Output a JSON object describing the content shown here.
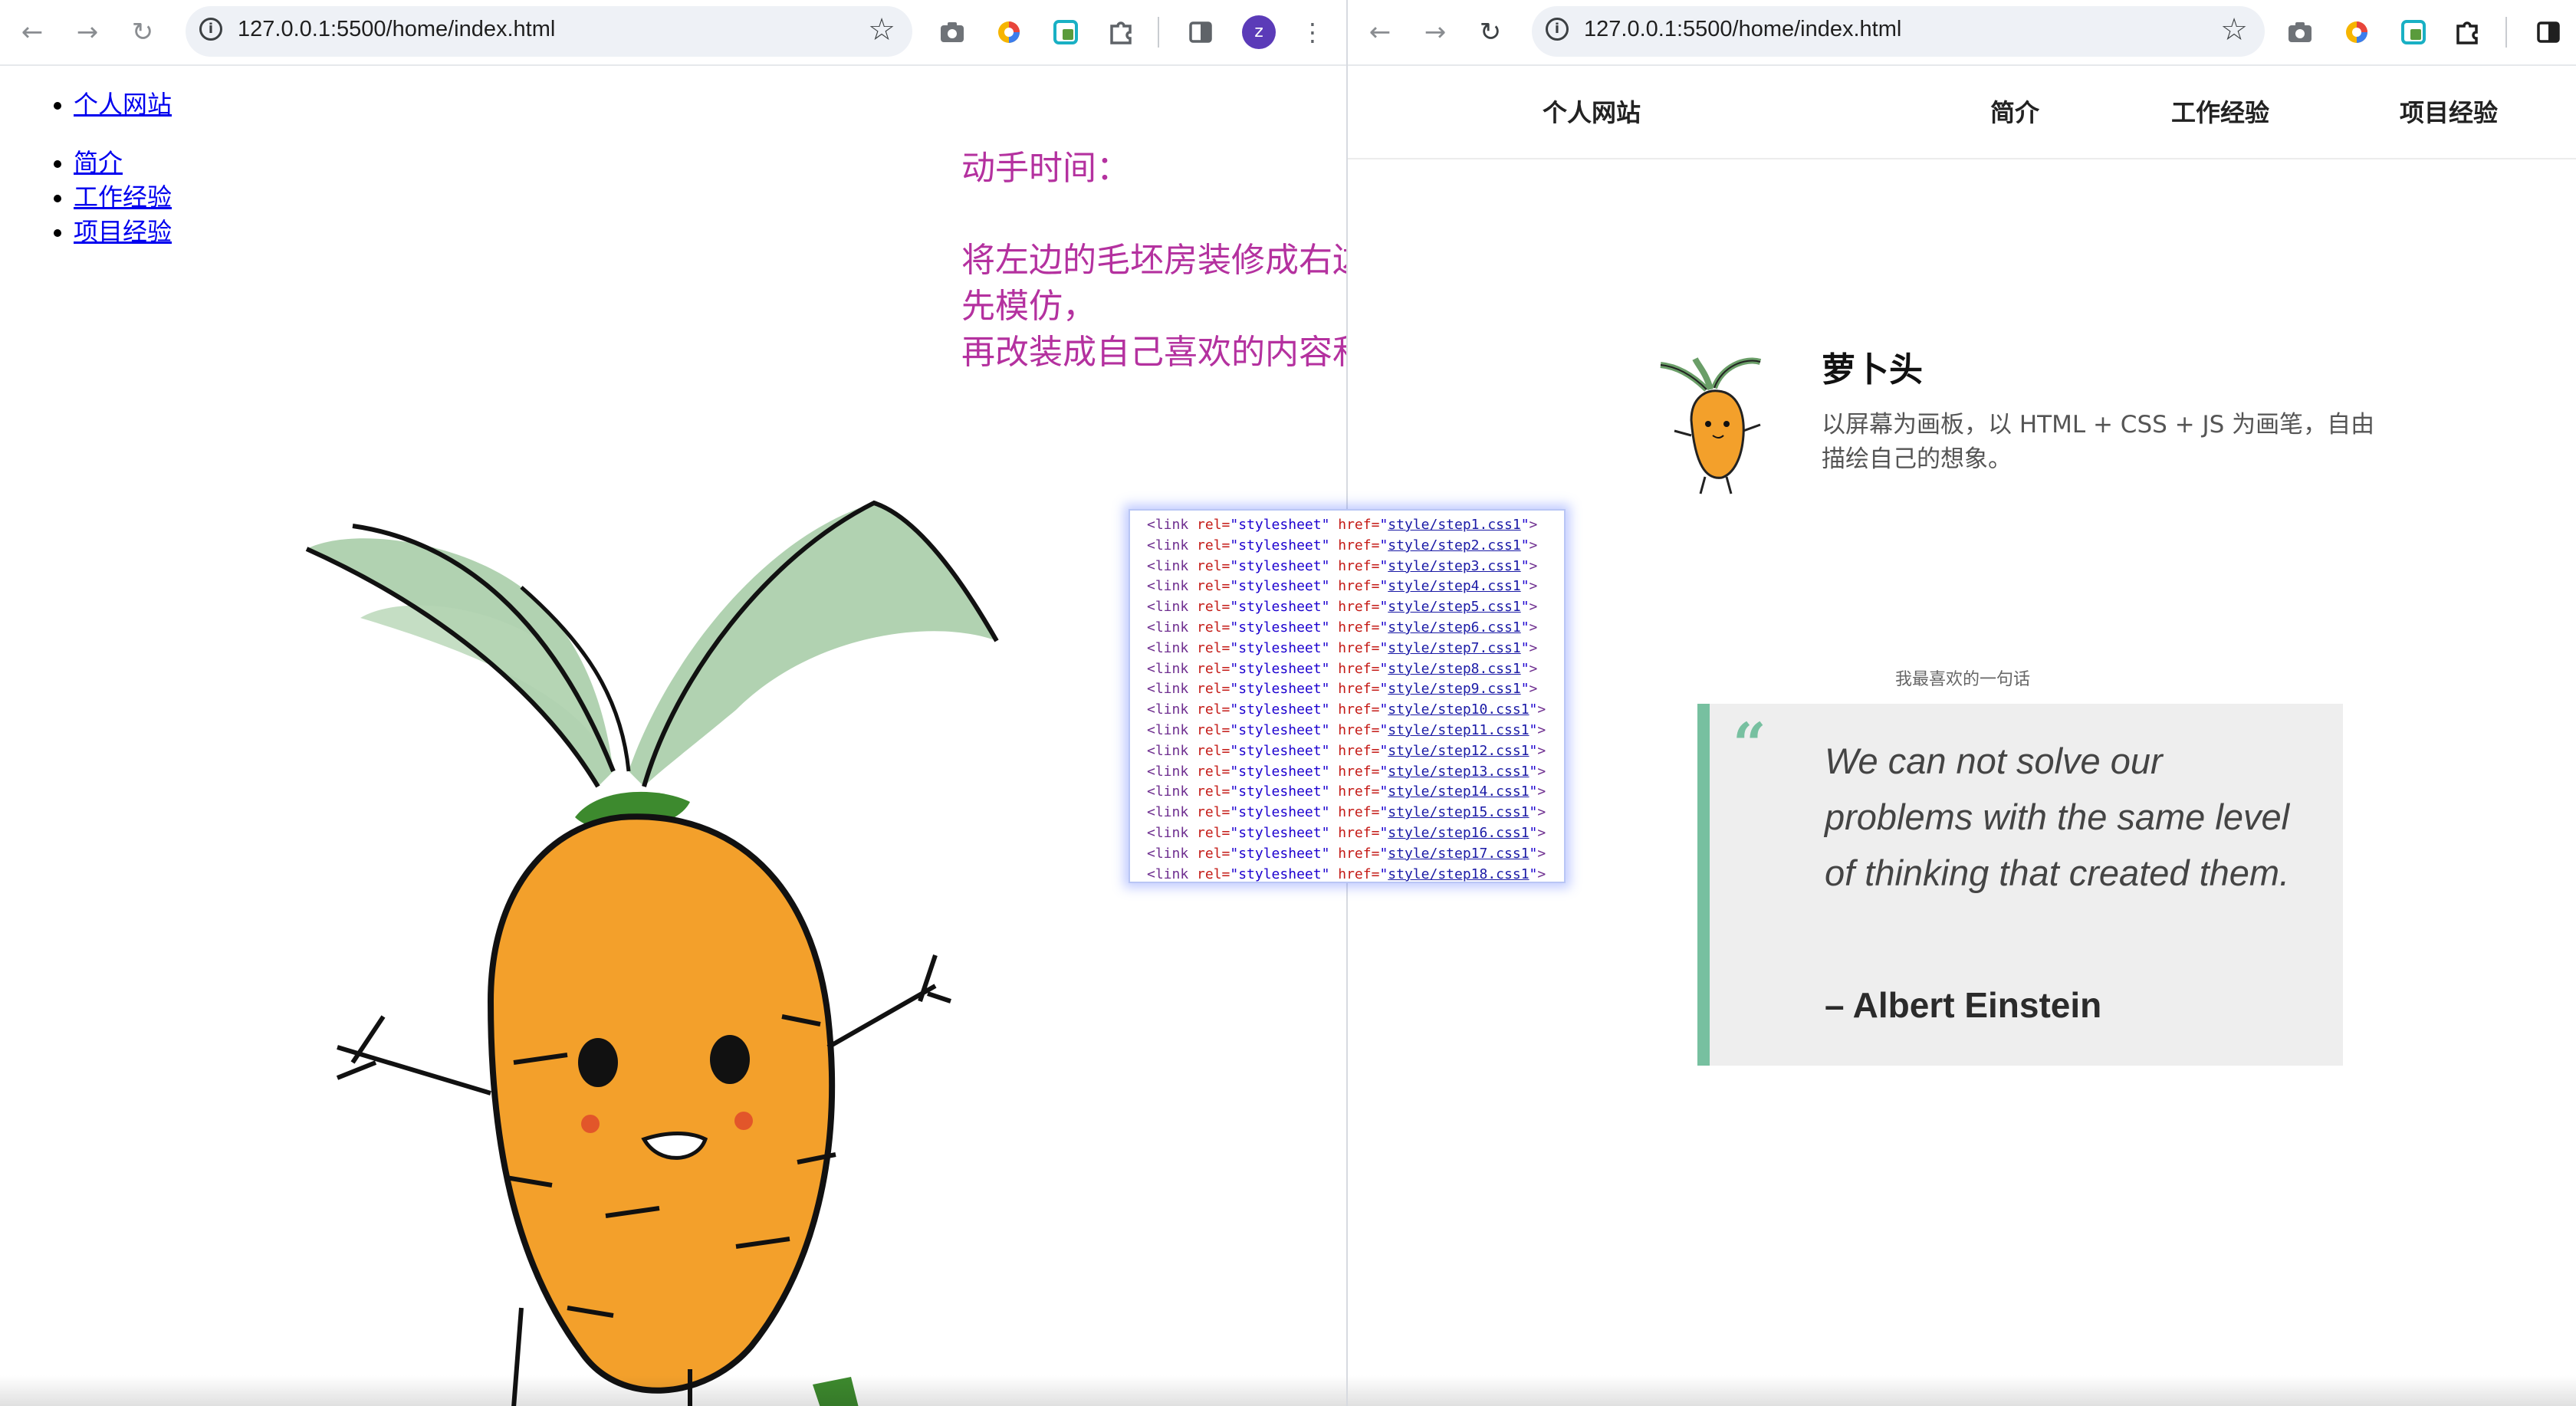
{
  "left_window": {
    "url": "127.0.0.1:5500/home/index.html",
    "avatar_letter": "z",
    "site_link": "个人网站",
    "nav_links": [
      "简介",
      "工作经验",
      "项目经验"
    ],
    "note": {
      "line1": "动手时间：",
      "line2": "将左边的毛坯房装修成右边的精装房",
      "line3": "先模仿，",
      "line4": "再改装成自己喜欢的内容和风格"
    },
    "code_lines": [
      {
        "tag": "<link",
        "attr1": " rel=",
        "val1": "\"stylesheet\"",
        "attr2": " href=",
        "q1": "\"",
        "href": "style/step1.css1",
        "q2": "\"",
        "end": ">"
      },
      {
        "tag": "<link",
        "attr1": " rel=",
        "val1": "\"stylesheet\"",
        "attr2": " href=",
        "q1": "\"",
        "href": "style/step2.css1",
        "q2": "\"",
        "end": ">"
      },
      {
        "tag": "<link",
        "attr1": " rel=",
        "val1": "\"stylesheet\"",
        "attr2": " href=",
        "q1": "\"",
        "href": "style/step3.css1",
        "q2": "\"",
        "end": ">"
      },
      {
        "tag": "<link",
        "attr1": " rel=",
        "val1": "\"stylesheet\"",
        "attr2": " href=",
        "q1": "\"",
        "href": "style/step4.css1",
        "q2": "\"",
        "end": ">"
      },
      {
        "tag": "<link",
        "attr1": " rel=",
        "val1": "\"stylesheet\"",
        "attr2": " href=",
        "q1": "\"",
        "href": "style/step5.css1",
        "q2": "\"",
        "end": ">"
      },
      {
        "tag": "<link",
        "attr1": " rel=",
        "val1": "\"stylesheet\"",
        "attr2": " href=",
        "q1": "\"",
        "href": "style/step6.css1",
        "q2": "\"",
        "end": ">"
      },
      {
        "tag": "<link",
        "attr1": " rel=",
        "val1": "\"stylesheet\"",
        "attr2": " href=",
        "q1": "\"",
        "href": "style/step7.css1",
        "q2": "\"",
        "end": ">"
      },
      {
        "tag": "<link",
        "attr1": " rel=",
        "val1": "\"stylesheet\"",
        "attr2": " href=",
        "q1": "\"",
        "href": "style/step8.css1",
        "q2": "\"",
        "end": ">"
      },
      {
        "tag": "<link",
        "attr1": " rel=",
        "val1": "\"stylesheet\"",
        "attr2": " href=",
        "q1": "\"",
        "href": "style/step9.css1",
        "q2": "\"",
        "end": ">"
      },
      {
        "tag": "<link",
        "attr1": " rel=",
        "val1": "\"stylesheet\"",
        "attr2": " href=",
        "q1": "\"",
        "href": "style/step10.css1",
        "q2": "\"",
        "end": ">"
      },
      {
        "tag": "<link",
        "attr1": " rel=",
        "val1": "\"stylesheet\"",
        "attr2": " href=",
        "q1": "\"",
        "href": "style/step11.css1",
        "q2": "\"",
        "end": ">"
      },
      {
        "tag": "<link",
        "attr1": " rel=",
        "val1": "\"stylesheet\"",
        "attr2": " href=",
        "q1": "\"",
        "href": "style/step12.css1",
        "q2": "\"",
        "end": ">"
      },
      {
        "tag": "<link",
        "attr1": " rel=",
        "val1": "\"stylesheet\"",
        "attr2": " href=",
        "q1": "\"",
        "href": "style/step13.css1",
        "q2": "\"",
        "end": ">"
      },
      {
        "tag": "<link",
        "attr1": " rel=",
        "val1": "\"stylesheet\"",
        "attr2": " href=",
        "q1": "\"",
        "href": "style/step14.css1",
        "q2": "\"",
        "end": ">"
      },
      {
        "tag": "<link",
        "attr1": " rel=",
        "val1": "\"stylesheet\"",
        "attr2": " href=",
        "q1": "\"",
        "href": "style/step15.css1",
        "q2": "\"",
        "end": ">"
      },
      {
        "tag": "<link",
        "attr1": " rel=",
        "val1": "\"stylesheet\"",
        "attr2": " href=",
        "q1": "\"",
        "href": "style/step16.css1",
        "q2": "\"",
        "end": ">"
      },
      {
        "tag": "<link",
        "attr1": " rel=",
        "val1": "\"stylesheet\"",
        "attr2": " href=",
        "q1": "\"",
        "href": "style/step17.css1",
        "q2": "\"",
        "end": ">"
      },
      {
        "tag": "<link",
        "attr1": " rel=",
        "val1": "\"stylesheet\"",
        "attr2": " href=",
        "q1": "\"",
        "href": "style/step18.css1",
        "q2": "\"",
        "end": ">"
      }
    ]
  },
  "right_window": {
    "url": "127.0.0.1:5500/home/index.html",
    "nav": {
      "brand": "个人网站",
      "links": [
        "简介",
        "工作经验",
        "项目经验"
      ]
    },
    "profile": {
      "name": "萝卜头",
      "desc_line1": "以屏幕为画板，以 HTML + CSS + JS 为画笔，自由",
      "desc_line2": "描绘自己的想象。"
    },
    "favorite_label": "我最喜欢的一句话",
    "quote": {
      "mark": "“",
      "text": "We can not solve our problems with the same level of thinking that created them.",
      "author": "– Albert Einstein"
    }
  },
  "colors": {
    "note_purple": "#b4319f",
    "quote_accent": "#77c0a0",
    "quote_bg": "#eeeeee",
    "link_blue": "#0000ee",
    "carrot_orange": "#f3a02b",
    "leaf_green": "#a9cda8",
    "avatar_purple": "#5b3bb8"
  },
  "icons": [
    "back-arrow-icon",
    "forward-arrow-icon",
    "reload-icon",
    "site-info-icon",
    "bookmark-star-icon",
    "camera-icon",
    "extension-icon",
    "puzzle-icon",
    "side-panel-icon",
    "menu-dots-icon"
  ]
}
